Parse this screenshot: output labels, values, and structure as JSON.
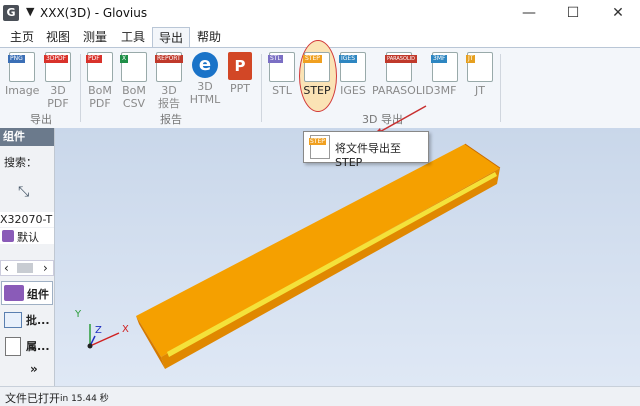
{
  "window": {
    "title": "XXX(3D) - Glovius",
    "app_icon_letter": "G",
    "quick_access": "▼",
    "controls": {
      "minimize": "—",
      "maximize": "☐",
      "close": "✕"
    }
  },
  "menu": [
    "主页",
    "视图",
    "测量",
    "工具",
    "导出",
    "帮助"
  ],
  "ribbon": {
    "buttons": [
      {
        "label1": "Image",
        "label2": "",
        "tag": "PNG",
        "color": "#3b6fb6",
        "icon": "image-export-icon"
      },
      {
        "label1": "3D",
        "label2": "PDF",
        "tag": "3DPDF",
        "color": "#d9322b",
        "icon": "pdf-3d-icon"
      },
      {
        "label1": "BoM",
        "label2": "PDF",
        "tag": "PDF",
        "color": "#d9322b",
        "icon": "bom-pdf-icon"
      },
      {
        "label1": "BoM",
        "label2": "CSV",
        "tag": "X",
        "color": "#1f8f48",
        "icon": "bom-csv-icon"
      },
      {
        "label1": "3D",
        "label2": "报告",
        "tag": "REPORT",
        "color": "#c0392b",
        "icon": "report-3d-icon"
      },
      {
        "label1": "3D",
        "label2": "HTML",
        "tag": "e",
        "color": "#1a73c8",
        "icon": "html-3d-icon"
      },
      {
        "label1": "PPT",
        "label2": "",
        "tag": "P",
        "color": "#d24726",
        "icon": "ppt-icon"
      },
      {
        "label1": "STL",
        "label2": "",
        "tag": "STL",
        "color": "#7b6fc4",
        "icon": "stl-icon"
      },
      {
        "label1": "STEP",
        "label2": "",
        "tag": "STEP",
        "color": "#f0a020",
        "icon": "step-icon"
      },
      {
        "label1": "IGES",
        "label2": "",
        "tag": "IGES",
        "color": "#2e86c1",
        "icon": "iges-icon"
      },
      {
        "label1": "PARASOLID",
        "label2": "",
        "tag": "PARASOLID",
        "color": "#c0392b",
        "icon": "parasolid-icon"
      },
      {
        "label1": "3MF",
        "label2": "",
        "tag": "3MF",
        "color": "#2e86c1",
        "icon": "3mf-icon"
      },
      {
        "label1": "JT",
        "label2": "",
        "tag": "JT",
        "color": "#e6a020",
        "icon": "jt-icon"
      }
    ],
    "groups": {
      "export": "导出",
      "report": "报告",
      "export3d": "3D 导出"
    }
  },
  "tooltip": {
    "text": "将文件导出至 STEP",
    "tag": "STEP"
  },
  "left_panel": {
    "header": "组件",
    "search_label": "搜索：",
    "collapse_symbol": "⤡",
    "assembly_name": "X32070-T",
    "default_item": "默认",
    "scroll_left": "‹",
    "scroll_right": "›",
    "tabs": [
      "组件",
      "批...",
      "属..."
    ],
    "more": "»"
  },
  "viewport": {
    "axis_labels": {
      "x": "X",
      "y": "Y",
      "z": "Z"
    },
    "colors": {
      "part_face": "#ffa800",
      "part_edge": "#e07a00",
      "stripe": "#f4e23a"
    }
  },
  "status": {
    "text": "文件已打开",
    "detail": "in 15.44 秒"
  }
}
